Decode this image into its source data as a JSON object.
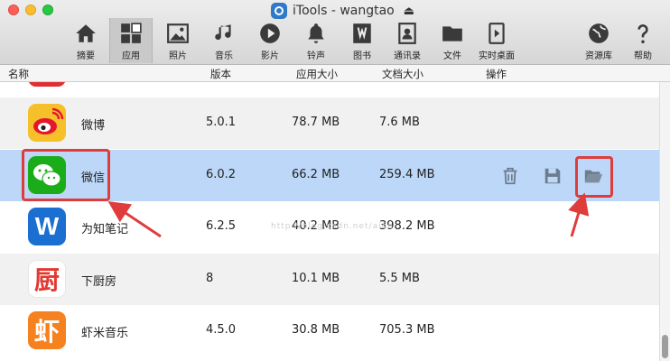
{
  "window": {
    "title": "iTools - wangtao"
  },
  "toolbar": {
    "items": [
      {
        "label": "摘要"
      },
      {
        "label": "应用"
      },
      {
        "label": "照片"
      },
      {
        "label": "音乐"
      },
      {
        "label": "影片"
      },
      {
        "label": "铃声"
      },
      {
        "label": "图书"
      },
      {
        "label": "通讯录"
      },
      {
        "label": "文件"
      },
      {
        "label": "实时桌面"
      },
      {
        "label": "资源库"
      },
      {
        "label": "帮助"
      }
    ]
  },
  "columns": {
    "name": "名称",
    "version": "版本",
    "app_size": "应用大小",
    "doc_size": "文档大小",
    "actions": "操作"
  },
  "apps": [
    {
      "name": "微博",
      "version": "5.0.1",
      "app_size": "78.7 MB",
      "doc_size": "7.6 MB"
    },
    {
      "name": "微信",
      "version": "6.0.2",
      "app_size": "66.2 MB",
      "doc_size": "259.4 MB"
    },
    {
      "name": "为知笔记",
      "version": "6.2.5",
      "app_size": "40.2 MB",
      "doc_size": "398.2 MB"
    },
    {
      "name": "下厨房",
      "version": "8",
      "app_size": "10.1 MB",
      "doc_size": "5.5 MB"
    },
    {
      "name": "虾米音乐",
      "version": "4.5.0",
      "app_size": "30.8 MB",
      "doc_size": "705.3 MB"
    }
  ],
  "icon_glyphs": {
    "wiz": "W",
    "xiachufang": "厨",
    "xiami": "虾"
  },
  "watermark": "http://blog.csdn.net/aide",
  "colors": {
    "selected_row": "#bcd7f8",
    "highlight": "#e03c3c",
    "wechat": "#1aad19",
    "weibo": "#f5c02a",
    "wiz": "#1a6fd1",
    "xiachufang": "#e2382f",
    "xiami": "#f6811f"
  }
}
